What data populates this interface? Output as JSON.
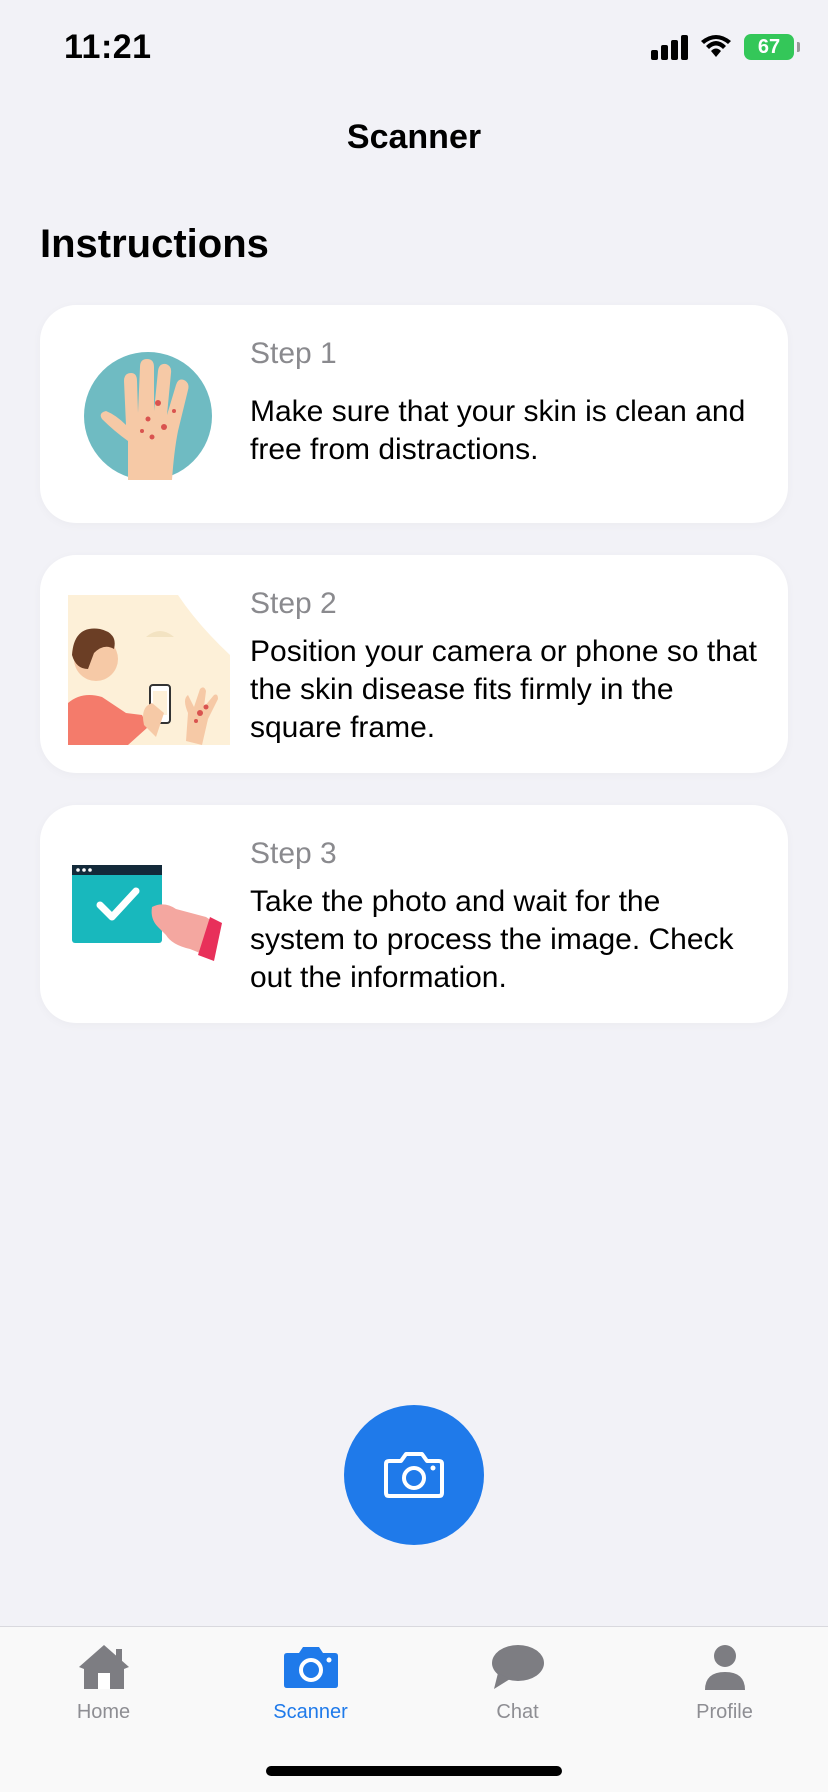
{
  "status_bar": {
    "time": "11:21",
    "battery": "67"
  },
  "header": {
    "title": "Scanner"
  },
  "instructions": {
    "title": "Instructions",
    "steps": [
      {
        "label": "Step 1",
        "text": "Make sure that your skin is clean and free from distractions."
      },
      {
        "label": "Step 2",
        "text": "Position your camera or phone so that the skin disease fits firmly in the square frame."
      },
      {
        "label": "Step 3",
        "text": "Take the photo and wait for the system to process the image. Check out the information."
      }
    ]
  },
  "tab_bar": {
    "items": [
      {
        "label": "Home",
        "icon": "house-icon"
      },
      {
        "label": "Scanner",
        "icon": "camera-icon"
      },
      {
        "label": "Chat",
        "icon": "chat-bubble-icon"
      },
      {
        "label": "Profile",
        "icon": "person-icon"
      }
    ],
    "active": "Scanner"
  },
  "colors": {
    "accent": "#1f7aea",
    "inactive": "#8e8e93",
    "battery": "#34c759"
  }
}
